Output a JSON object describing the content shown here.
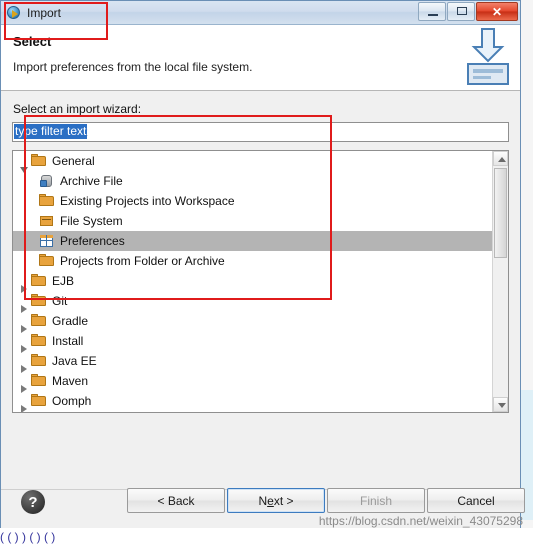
{
  "window": {
    "title": "Import",
    "title_icon": "import-globe-arrow-icon",
    "minimize_label": "Minimize",
    "maximize_label": "Maximize",
    "close_label": "✕"
  },
  "header": {
    "title": "Select",
    "description": "Import preferences from the local file system.",
    "banner_icon": "import-wizard-banner-icon"
  },
  "body": {
    "field_label": "Select an import wizard:",
    "filter": {
      "value": "type filter text",
      "placeholder": "type filter text"
    },
    "tree": [
      {
        "label": "General",
        "icon": "folder-icon",
        "expanded": true,
        "level": 1,
        "selected": false
      },
      {
        "label": "Archive File",
        "icon": "jar-icon",
        "expanded": null,
        "level": 2,
        "selected": false
      },
      {
        "label": "Existing Projects into Workspace",
        "icon": "folder-icon",
        "expanded": null,
        "level": 2,
        "selected": false
      },
      {
        "label": "File System",
        "icon": "file-system-icon",
        "expanded": null,
        "level": 2,
        "selected": false
      },
      {
        "label": "Preferences",
        "icon": "preferences-icon",
        "expanded": null,
        "level": 2,
        "selected": true
      },
      {
        "label": "Projects from Folder or Archive",
        "icon": "folder-icon",
        "expanded": null,
        "level": 2,
        "selected": false
      },
      {
        "label": "EJB",
        "icon": "folder-icon",
        "expanded": false,
        "level": 1,
        "selected": false
      },
      {
        "label": "Git",
        "icon": "folder-icon",
        "expanded": false,
        "level": 1,
        "selected": false
      },
      {
        "label": "Gradle",
        "icon": "folder-icon",
        "expanded": false,
        "level": 1,
        "selected": false
      },
      {
        "label": "Install",
        "icon": "folder-icon",
        "expanded": false,
        "level": 1,
        "selected": false
      },
      {
        "label": "Java EE",
        "icon": "folder-icon",
        "expanded": false,
        "level": 1,
        "selected": false
      },
      {
        "label": "Maven",
        "icon": "folder-icon",
        "expanded": false,
        "level": 1,
        "selected": false
      },
      {
        "label": "Oomph",
        "icon": "folder-icon",
        "expanded": false,
        "level": 1,
        "selected": false
      }
    ]
  },
  "footer": {
    "help_label": "?",
    "back_label": "< Back",
    "next_label_pre": "N",
    "next_label_underline": "e",
    "next_label_post": "xt >",
    "finish_label": "Finish",
    "cancel_label": "Cancel"
  },
  "overlay": {
    "watermark": "https://blog.csdn.net/weixin_43075298",
    "bottom_text": "( (  ) )  ( ) (  )"
  },
  "colors": {
    "annotation": "#e01b1b",
    "selection": "#b4b4b4",
    "accent": "#2b6fc4",
    "folder": "#e8a33d"
  }
}
